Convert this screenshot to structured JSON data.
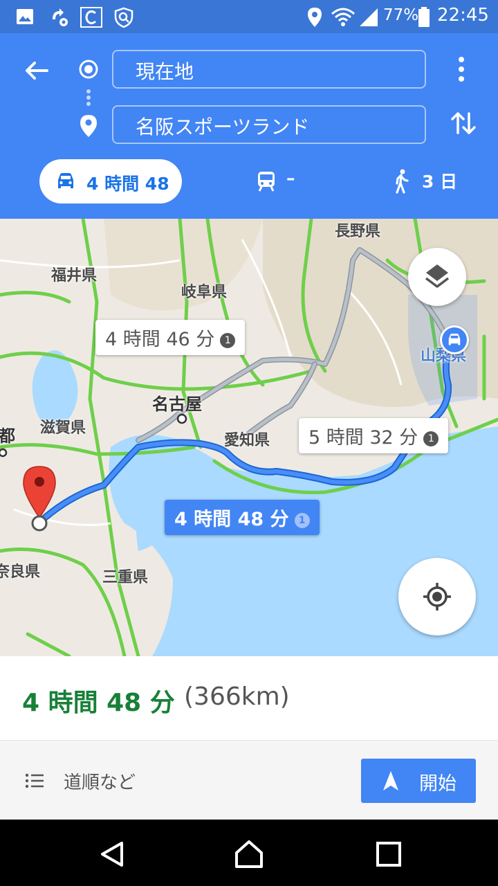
{
  "status_bar": {
    "battery": "77%",
    "time": "22:45"
  },
  "header": {
    "origin": "現在地",
    "destination": "名阪スポーツランド",
    "modes": [
      {
        "label": "4 時間 48",
        "icon": "car-icon",
        "selected": true
      },
      {
        "label": "–",
        "icon": "train-icon",
        "selected": false
      },
      {
        "label": "3 日",
        "icon": "walk-icon",
        "selected": false
      }
    ]
  },
  "map": {
    "labels": {
      "nagano": "長野県",
      "fukui": "福井県",
      "gifu": "岐阜県",
      "yamanashi": "山梨県",
      "nagoya": "名古屋",
      "kyoto": "京都",
      "shiga": "滋賀県",
      "aichi": "愛知県",
      "nara": "奈良県",
      "mie": "三重県"
    },
    "routes": [
      {
        "label": "4 時間 46 分",
        "selected": false
      },
      {
        "label": "5 時間 32 分",
        "selected": false
      },
      {
        "label": "4 時間 48 分",
        "selected": true
      }
    ],
    "info_glyph": "1"
  },
  "summary": {
    "duration": "4 時間 48 分",
    "distance": "(366km)"
  },
  "actions": {
    "steps_label": "道順など",
    "start_label": "開始"
  },
  "colors": {
    "header": "#4285f4",
    "status_bar": "#3a76d6",
    "route_selected": "#4285f4",
    "route_alt": "#9aa3ad",
    "duration_green": "#188038"
  }
}
